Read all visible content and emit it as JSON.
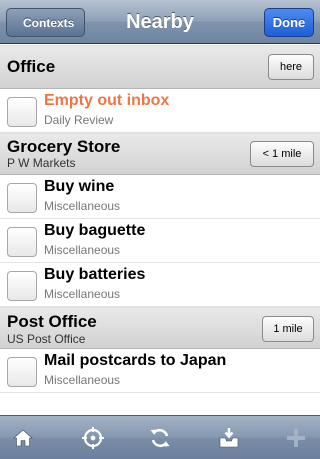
{
  "navbar": {
    "back_label": "Contexts",
    "title": "Nearby",
    "done_label": "Done"
  },
  "sections": [
    {
      "title": "Office",
      "subtitle": "",
      "distance": "here",
      "items": [
        {
          "title": "Empty out inbox",
          "subtitle": "Daily Review",
          "overdue": true
        }
      ]
    },
    {
      "title": "Grocery Store",
      "subtitle": "P W Markets",
      "distance": "< 1 mile",
      "items": [
        {
          "title": "Buy wine",
          "subtitle": "Miscellaneous"
        },
        {
          "title": "Buy baguette",
          "subtitle": "Miscellaneous"
        },
        {
          "title": "Buy batteries",
          "subtitle": "Miscellaneous"
        }
      ]
    },
    {
      "title": "Post Office",
      "subtitle": "US Post Office",
      "distance": "1 mile",
      "items": [
        {
          "title": "Mail postcards to Japan",
          "subtitle": "Miscellaneous"
        }
      ]
    }
  ],
  "toolbar": {
    "icons": [
      "home-icon",
      "location-target-icon",
      "sync-icon",
      "inbox-icon",
      "add-icon"
    ]
  },
  "colors": {
    "overdue": "#ef7642",
    "done_button": "#2a6ae0",
    "navbar": "#8d9fb6"
  }
}
